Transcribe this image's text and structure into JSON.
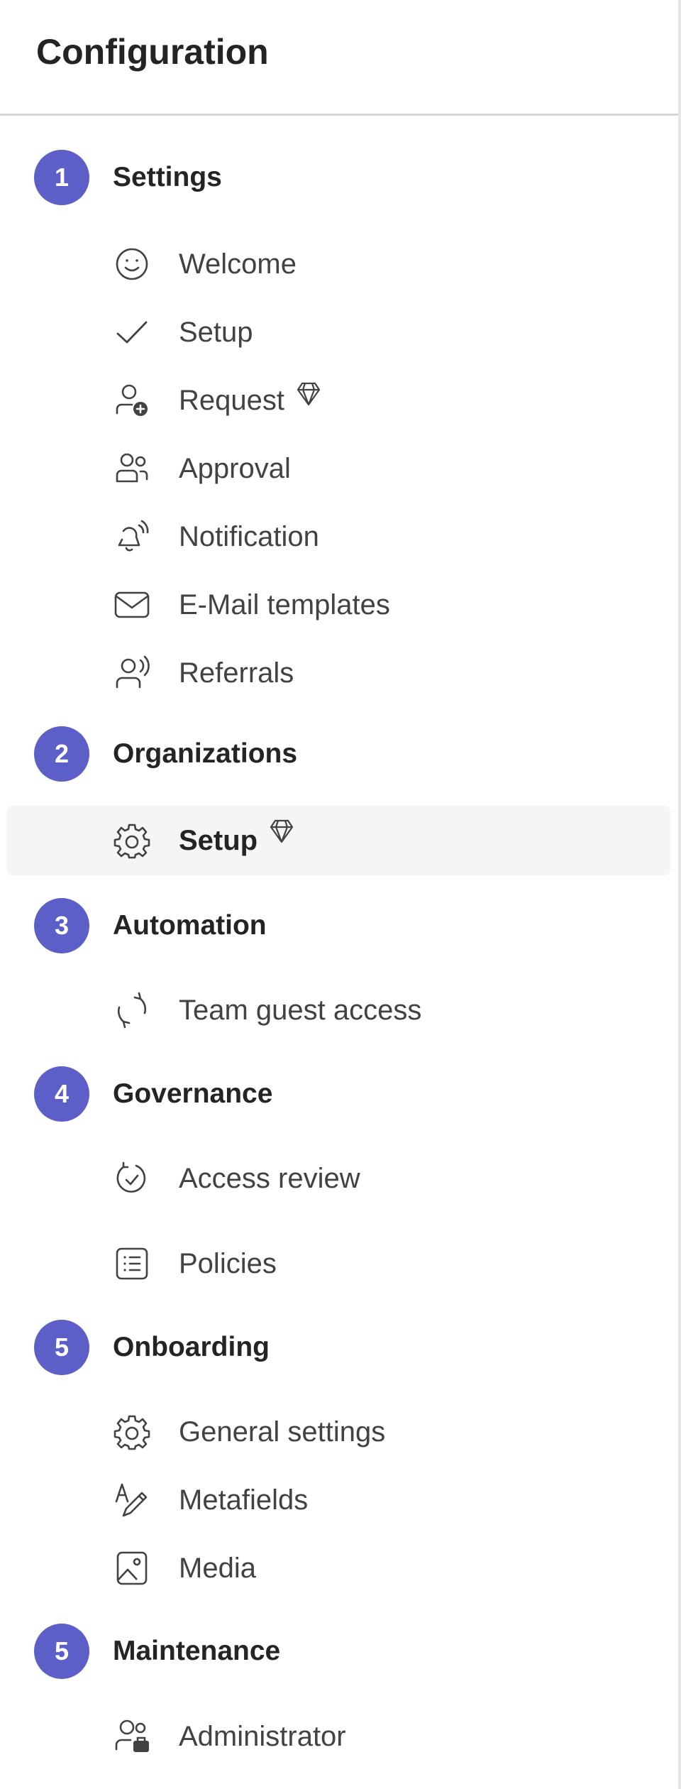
{
  "header": {
    "title": "Configuration"
  },
  "sections": [
    {
      "number": "1",
      "label": "Settings"
    },
    {
      "number": "2",
      "label": "Organizations"
    },
    {
      "number": "3",
      "label": "Automation"
    },
    {
      "number": "4",
      "label": "Governance"
    },
    {
      "number": "5",
      "label": "Onboarding"
    },
    {
      "number": "5",
      "label": "Maintenance"
    }
  ],
  "items": {
    "welcome": {
      "label": "Welcome",
      "icon": "smiley-icon"
    },
    "setup": {
      "label": "Setup",
      "icon": "checkmark-icon"
    },
    "request": {
      "label": "Request",
      "icon": "person-add-icon",
      "premium": true
    },
    "approval": {
      "label": "Approval",
      "icon": "people-icon"
    },
    "notification": {
      "label": "Notification",
      "icon": "bell-ring-icon"
    },
    "email_templates": {
      "label": "E-Mail templates",
      "icon": "mail-icon"
    },
    "referrals": {
      "label": "Referrals",
      "icon": "person-voice-icon"
    },
    "org_setup": {
      "label": "Setup",
      "icon": "gear-icon",
      "premium": true,
      "selected": true
    },
    "team_guest_access": {
      "label": "Team guest access",
      "icon": "sync-icon"
    },
    "access_review": {
      "label": "Access review",
      "icon": "arrow-sync-check-icon"
    },
    "policies": {
      "label": "Policies",
      "icon": "list-icon"
    },
    "general_settings": {
      "label": "General settings",
      "icon": "gear-icon"
    },
    "metafields": {
      "label": "Metafields",
      "icon": "text-edit-icon"
    },
    "media": {
      "label": "Media",
      "icon": "image-icon"
    },
    "administrator": {
      "label": "Administrator",
      "icon": "person-admin-icon"
    }
  },
  "colors": {
    "accent": "#5b5fc7",
    "selected_bg": "#f5f5f5",
    "text": "#242424",
    "muted_text": "#424242"
  }
}
